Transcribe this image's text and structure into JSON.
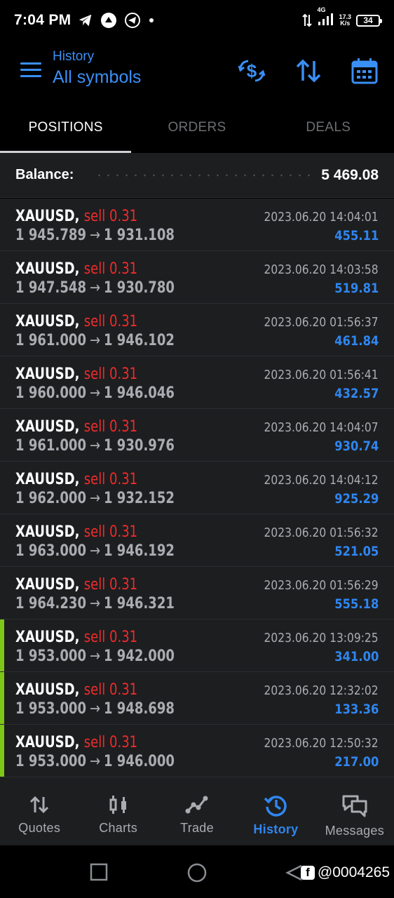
{
  "status_bar": {
    "time": "7:04 PM",
    "network": "4G",
    "speed_value": "17.3",
    "speed_unit": "K/s",
    "battery": "34"
  },
  "header": {
    "subtitle": "History",
    "title": "All symbols",
    "icons": [
      "hamburger-menu-icon",
      "currency-exchange-icon",
      "sort-icon",
      "calendar-icon"
    ]
  },
  "tabs": [
    {
      "label": "POSITIONS",
      "active": true
    },
    {
      "label": "ORDERS",
      "active": false
    },
    {
      "label": "DEALS",
      "active": false
    }
  ],
  "balance": {
    "label": "Balance:",
    "value": "5 469.08"
  },
  "positions": [
    {
      "symbol": "XAUUSD,",
      "direction": "sell 0.31",
      "open": "1 945.789",
      "arrow": "→",
      "close": "1 931.108",
      "date": "2023.06.20 14:04:01",
      "profit": "455.11",
      "marked": false
    },
    {
      "symbol": "XAUUSD,",
      "direction": "sell 0.31",
      "open": "1 947.548",
      "arrow": "→",
      "close": "1 930.780",
      "date": "2023.06.20 14:03:58",
      "profit": "519.81",
      "marked": false
    },
    {
      "symbol": "XAUUSD,",
      "direction": "sell 0.31",
      "open": "1 961.000",
      "arrow": "→",
      "close": "1 946.102",
      "date": "2023.06.20 01:56:37",
      "profit": "461.84",
      "marked": false
    },
    {
      "symbol": "XAUUSD,",
      "direction": "sell 0.31",
      "open": "1 960.000",
      "arrow": "→",
      "close": "1 946.046",
      "date": "2023.06.20 01:56:41",
      "profit": "432.57",
      "marked": false
    },
    {
      "symbol": "XAUUSD,",
      "direction": "sell 0.31",
      "open": "1 961.000",
      "arrow": "→",
      "close": "1 930.976",
      "date": "2023.06.20 14:04:07",
      "profit": "930.74",
      "marked": false
    },
    {
      "symbol": "XAUUSD,",
      "direction": "sell 0.31",
      "open": "1 962.000",
      "arrow": "→",
      "close": "1 932.152",
      "date": "2023.06.20 14:04:12",
      "profit": "925.29",
      "marked": false
    },
    {
      "symbol": "XAUUSD,",
      "direction": "sell 0.31",
      "open": "1 963.000",
      "arrow": "→",
      "close": "1 946.192",
      "date": "2023.06.20 01:56:32",
      "profit": "521.05",
      "marked": false
    },
    {
      "symbol": "XAUUSD,",
      "direction": "sell 0.31",
      "open": "1 964.230",
      "arrow": "→",
      "close": "1 946.321",
      "date": "2023.06.20 01:56:29",
      "profit": "555.18",
      "marked": false
    },
    {
      "symbol": "XAUUSD,",
      "direction": "sell 0.31",
      "open": "1 953.000",
      "arrow": "→",
      "close": "1 942.000",
      "date": "2023.06.20 13:09:25",
      "profit": "341.00",
      "marked": true
    },
    {
      "symbol": "XAUUSD,",
      "direction": "sell 0.31",
      "open": "1 953.000",
      "arrow": "→",
      "close": "1 948.698",
      "date": "2023.06.20 12:32:02",
      "profit": "133.36",
      "marked": true
    },
    {
      "symbol": "XAUUSD,",
      "direction": "sell 0.31",
      "open": "1 953.000",
      "arrow": "→",
      "close": "1 946.000",
      "date": "2023.06.20 12:50:32",
      "profit": "217.00",
      "marked": true
    }
  ],
  "bottom_nav": [
    {
      "label": "Quotes",
      "icon": "quotes-arrows-icon",
      "active": false
    },
    {
      "label": "Charts",
      "icon": "candlestick-chart-icon",
      "active": false
    },
    {
      "label": "Trade",
      "icon": "trend-line-icon",
      "active": false
    },
    {
      "label": "History",
      "icon": "history-clock-icon",
      "active": true
    },
    {
      "label": "Messages",
      "icon": "chat-bubbles-icon",
      "active": false
    }
  ],
  "watermark": {
    "text": "@0004265"
  },
  "colors": {
    "accent_blue": "#2f86f0",
    "sell_red": "#f02b2b",
    "marker_green": "#7ec617",
    "row_bg": "#1d1e20"
  }
}
